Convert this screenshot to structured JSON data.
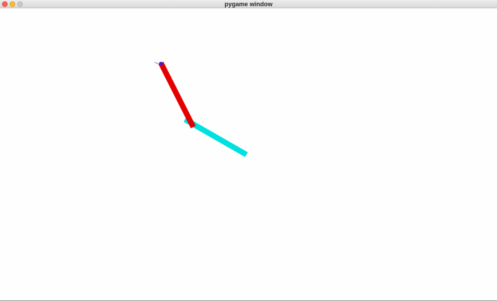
{
  "window": {
    "title": "pygame window",
    "controls": {
      "close_color": "#ff5f57",
      "minimize_color": "#febc2e",
      "zoom_color": "#c9c9c9"
    }
  },
  "scene": {
    "background_color": "#ffffff",
    "link1_color": "#e50000",
    "link2_color": "#00e0e0",
    "base_joint_color": "#2222ff",
    "target_marker_color": "#8888cc"
  }
}
